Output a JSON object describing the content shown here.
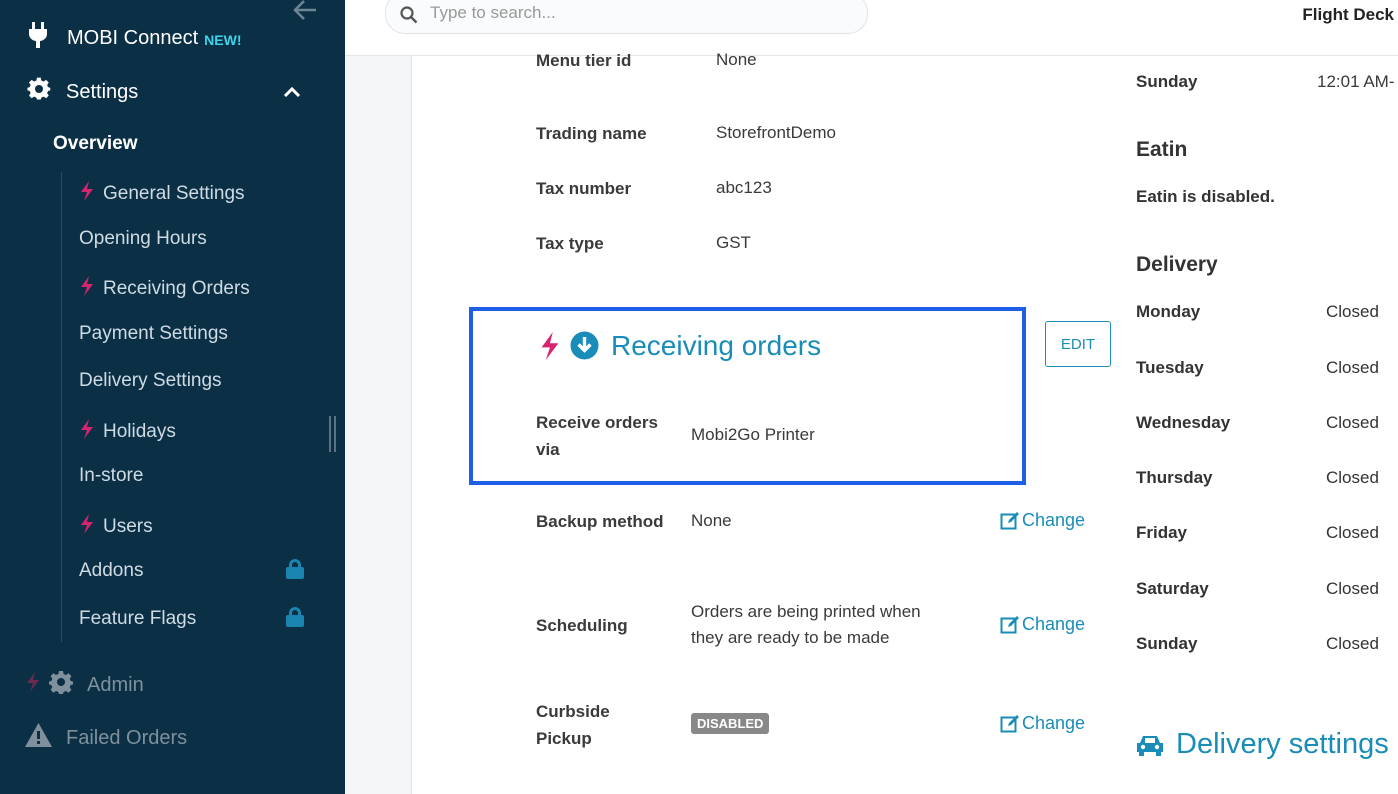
{
  "sidebar": {
    "brand": {
      "label": "MOBI Connect",
      "badge": "NEW!"
    },
    "settings_label": "Settings",
    "overview_label": "Overview",
    "items": [
      {
        "label": "General Settings",
        "flash": true
      },
      {
        "label": "Opening Hours",
        "flash": false
      },
      {
        "label": "Receiving Orders",
        "flash": true
      },
      {
        "label": "Payment Settings",
        "flash": false
      },
      {
        "label": "Delivery Settings",
        "flash": false
      },
      {
        "label": "Holidays",
        "flash": true
      },
      {
        "label": "In-store",
        "flash": false
      },
      {
        "label": "Users",
        "flash": true
      },
      {
        "label": "Addons",
        "locked": true
      },
      {
        "label": "Feature Flags",
        "locked": true
      }
    ],
    "admin_label": "Admin",
    "failed_label": "Failed Orders"
  },
  "search": {
    "placeholder": "Type to search..."
  },
  "store_name": "Flight Deck",
  "general": {
    "menu_tier_label": "Menu tier id",
    "menu_tier_value": "None",
    "trading_name_label": "Trading name",
    "trading_name_value": "StorefrontDemo",
    "tax_number_label": "Tax number",
    "tax_number_value": "abc123",
    "tax_type_label": "Tax type",
    "tax_type_value": "GST"
  },
  "receiving": {
    "title": "Receiving orders",
    "edit_label": "EDIT",
    "receive_via_label_1": "Receive orders",
    "receive_via_label_2": "via",
    "receive_via_value": "Mobi2Go Printer",
    "backup_label": "Backup method",
    "backup_value": "None",
    "scheduling_label": "Scheduling",
    "scheduling_value_1": "Orders are being printed when",
    "scheduling_value_2": "they are ready to be made",
    "curbside_label_1": "Curbside",
    "curbside_label_2": "Pickup",
    "curbside_value": "DISABLED",
    "change_label": "Change"
  },
  "right": {
    "top_day": "Sunday",
    "top_time": "12:01 AM-",
    "eatin_title": "Eatin",
    "eatin_text": "Eatin  is disabled.",
    "delivery_title": "Delivery",
    "delivery_days": [
      {
        "day": "Monday",
        "value": "Closed"
      },
      {
        "day": "Tuesday",
        "value": "Closed"
      },
      {
        "day": "Wednesday",
        "value": "Closed"
      },
      {
        "day": "Thursday",
        "value": "Closed"
      },
      {
        "day": "Friday",
        "value": "Closed"
      },
      {
        "day": "Saturday",
        "value": "Closed"
      },
      {
        "day": "Sunday",
        "value": "Closed"
      }
    ],
    "delivery_settings_title": "Delivery settings"
  },
  "colors": {
    "sidebar": "#0b2f45",
    "accent": "#1a8cb8",
    "flash": "#d6246e",
    "highlight": "#1e5de6"
  }
}
